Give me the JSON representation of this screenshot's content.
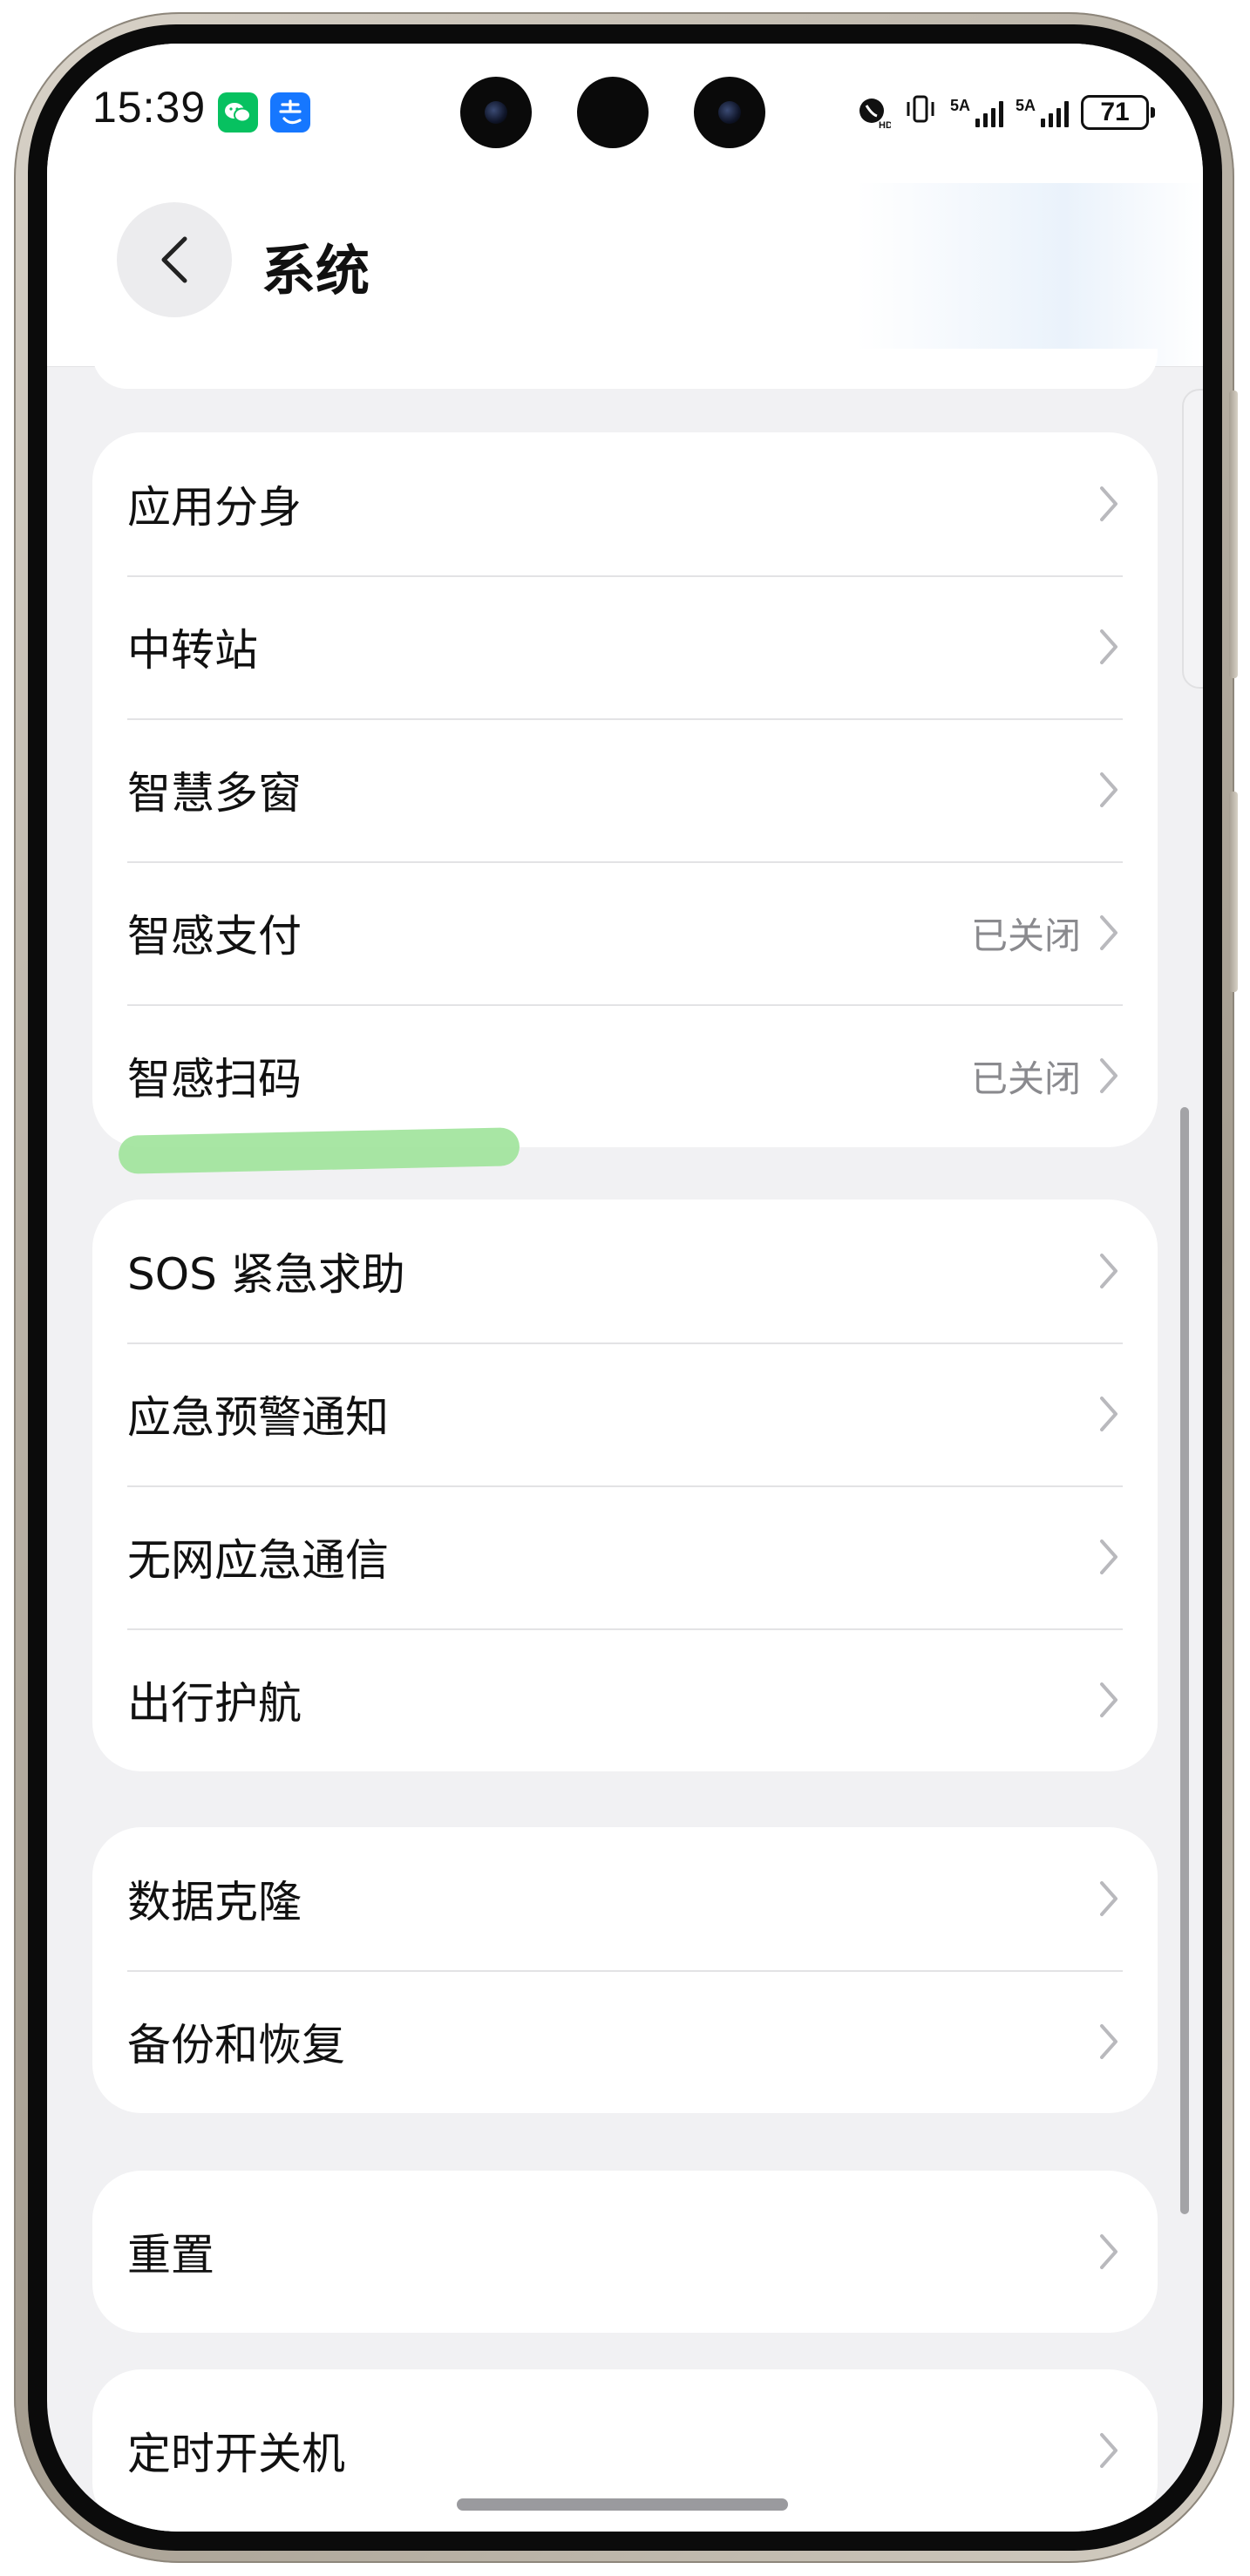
{
  "status_bar": {
    "time": "15:39",
    "apps": [
      "wechat-icon",
      "alipay-icon"
    ],
    "network_1": "5A",
    "network_2": "5A",
    "battery": "71"
  },
  "header": {
    "title": "系统",
    "back_icon": "chevron-left-icon"
  },
  "groups": [
    {
      "rows": [
        {
          "label": "应用分身",
          "value": ""
        },
        {
          "label": "中转站",
          "value": ""
        },
        {
          "label": "智慧多窗",
          "value": ""
        },
        {
          "label": "智感支付",
          "value": "已关闭"
        },
        {
          "label": "智感扫码",
          "value": "已关闭"
        }
      ]
    },
    {
      "rows": [
        {
          "label": "SOS 紧急求助",
          "value": ""
        },
        {
          "label": "应急预警通知",
          "value": ""
        },
        {
          "label": "无网应急通信",
          "value": ""
        },
        {
          "label": "出行护航",
          "value": ""
        }
      ]
    },
    {
      "rows": [
        {
          "label": "数据克隆",
          "value": ""
        },
        {
          "label": "备份和恢复",
          "value": ""
        }
      ]
    },
    {
      "rows": [
        {
          "label": "重置",
          "value": ""
        }
      ]
    },
    {
      "rows": [
        {
          "label": "定时开关机",
          "value": ""
        }
      ]
    }
  ],
  "colors": {
    "background": "#f1f1f3",
    "card": "#ffffff",
    "highlight": "#9fe39a",
    "secondary_text": "#8a8a8e"
  }
}
